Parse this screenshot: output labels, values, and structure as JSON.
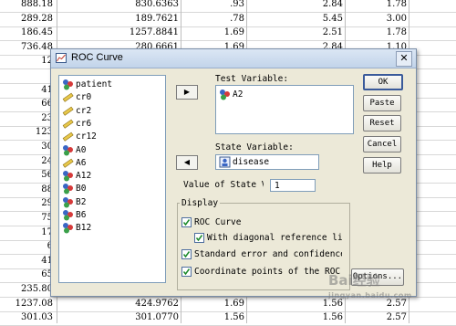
{
  "sheet": {
    "rows": [
      [
        "888.18",
        "830.6363",
        ".93",
        "2.84",
        "1.78"
      ],
      [
        "289.28",
        "189.7621",
        ".78",
        "5.45",
        "3.00"
      ],
      [
        "186.45",
        "1257.8841",
        "1.69",
        "2.51",
        "1.78"
      ],
      [
        "736.48",
        "280.6661",
        "1.69",
        "2.84",
        "1.10"
      ],
      [
        "12",
        "",
        "",
        "",
        ""
      ],
      [
        "",
        "",
        "",
        "",
        ""
      ],
      [
        "41",
        "",
        "",
        "",
        ""
      ],
      [
        "66",
        "",
        "",
        "",
        ""
      ],
      [
        "23",
        "",
        "",
        "",
        ""
      ],
      [
        "123",
        "",
        "",
        "",
        ""
      ],
      [
        "30",
        "",
        "",
        "",
        ""
      ],
      [
        "24",
        "",
        "",
        "",
        ""
      ],
      [
        "56",
        "",
        "",
        "",
        ""
      ],
      [
        "88",
        "",
        "",
        "",
        ""
      ],
      [
        "29",
        "",
        "",
        "",
        ""
      ],
      [
        "75",
        "",
        "",
        "",
        ""
      ],
      [
        "17",
        "",
        "",
        "",
        ""
      ],
      [
        "6",
        "",
        "",
        "",
        ""
      ],
      [
        "41",
        "",
        "",
        "",
        ""
      ],
      [
        "65",
        "",
        "",
        "",
        ""
      ],
      [
        "235.80",
        "424.9162",
        "1.69",
        "2.84",
        "1.78"
      ],
      [
        "1237.08",
        "424.9762",
        "1.69",
        "1.56",
        "2.57"
      ],
      [
        "301.03",
        "301.0770",
        "1.56",
        "1.56",
        "2.57"
      ]
    ]
  },
  "dialog": {
    "title": "ROC Curve",
    "close_glyph": "✕",
    "variables": [
      {
        "name": "patient",
        "icon": "nominal-icon"
      },
      {
        "name": "cr0",
        "icon": "scale-icon"
      },
      {
        "name": "cr2",
        "icon": "scale-icon"
      },
      {
        "name": "cr6",
        "icon": "scale-icon"
      },
      {
        "name": "cr12",
        "icon": "scale-icon"
      },
      {
        "name": "A0",
        "icon": "nominal-icon"
      },
      {
        "name": "A6",
        "icon": "scale-icon"
      },
      {
        "name": "A12",
        "icon": "nominal-icon"
      },
      {
        "name": "B0",
        "icon": "nominal-icon"
      },
      {
        "name": "B2",
        "icon": "nominal-icon"
      },
      {
        "name": "B6",
        "icon": "nominal-icon"
      },
      {
        "name": "B12",
        "icon": "nominal-icon"
      }
    ],
    "test_variable_label": "Test Variable:",
    "test_variables": [
      "A2"
    ],
    "state_variable_label": "State Variable:",
    "state_variable_value": "disease",
    "value_of_state_label": "Value of State Variable:",
    "value_of_state_value": "1",
    "buttons": {
      "ok": "OK",
      "paste": "Paste",
      "reset": "Reset",
      "cancel": "Cancel",
      "help": "Help",
      "options": "Options..."
    },
    "display": {
      "legend": "Display",
      "roc_curve": {
        "label": "ROC Curve",
        "checked": true
      },
      "diagonal": {
        "label": "With diagonal reference line",
        "checked": true
      },
      "std_error": {
        "label": "Standard error and confidence interval",
        "checked": true
      },
      "coord_points": {
        "label": "Coordinate points of the ROC Curve",
        "checked": true
      }
    },
    "arrow_glyph": "▶",
    "arrow_left_glyph": "◀"
  },
  "watermark": {
    "text": "Bai经验",
    "sub": "jingyan.baidu.com"
  }
}
